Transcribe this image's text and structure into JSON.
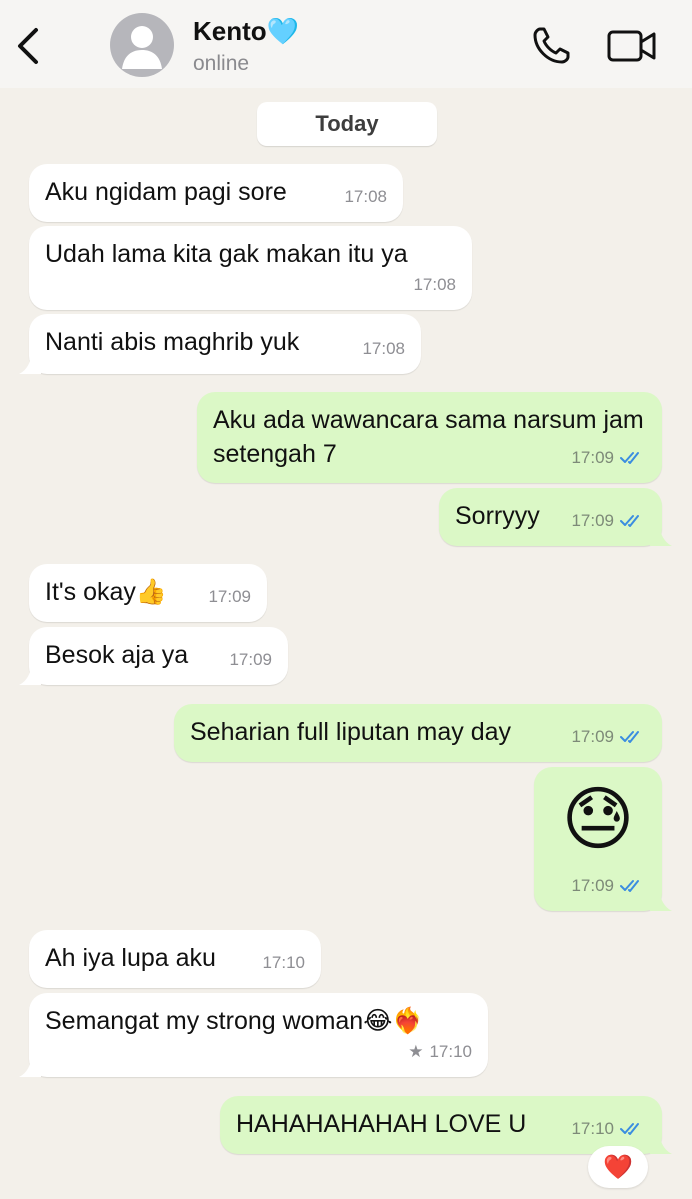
{
  "header": {
    "contact_name": "Kento",
    "name_emoji": "🩵",
    "status": "online"
  },
  "date_separator": "Today",
  "messages": [
    {
      "dir": "in",
      "text": "Aku ngidam pagi sore",
      "time": "17:08"
    },
    {
      "dir": "in",
      "text": "Udah lama kita gak makan itu ya",
      "time": "17:08"
    },
    {
      "dir": "in",
      "text": "Nanti abis maghrib yuk",
      "time": "17:08"
    },
    {
      "dir": "out",
      "text": "Aku ada wawancara sama narsum jam setengah 7",
      "time": "17:09"
    },
    {
      "dir": "out",
      "text": "Sorryyy",
      "time": "17:09"
    },
    {
      "dir": "in",
      "text": "It's okay👍",
      "time": "17:09"
    },
    {
      "dir": "in",
      "text": "Besok aja ya",
      "time": "17:09"
    },
    {
      "dir": "out",
      "text": "Seharian full liputan may day",
      "time": "17:09"
    },
    {
      "dir": "out",
      "text": "😓",
      "time": "17:09"
    },
    {
      "dir": "in",
      "text": "Ah iya lupa aku",
      "time": "17:10"
    },
    {
      "dir": "in",
      "text": "Semangat my strong woman😂❤️‍🔥",
      "time": "17:10",
      "starred": "★"
    },
    {
      "dir": "out",
      "text": "HAHAHAHAHAH LOVE U",
      "time": "17:10"
    }
  ],
  "reaction": "❤️",
  "colors": {
    "background": "#f3f0ea",
    "incoming_bubble": "#ffffff",
    "outgoing_bubble": "#dbf8c6",
    "read_ticks": "#3b8de0"
  }
}
